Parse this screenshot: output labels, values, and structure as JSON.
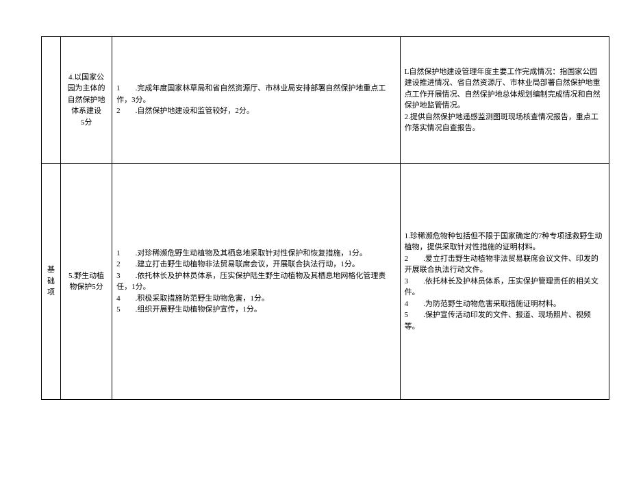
{
  "table": {
    "rows": [
      {
        "category": "",
        "item": "4.以国家公园为主体的自然保护地体系建设\n5分",
        "criteria": "1　　.完成年度国家林草局和省自然资源厅、市林业局安排部署自然保护地重点工作，3分。\n2　　.自然保护地建设和监管较好，2分。",
        "evidence": "L自然保护地建设管理年度主要工作完成情况：指国家公园建设推进情况、省自然资源厅、市林业局部署自然保护地重点工作开展情况、自然保护地总体规划编制完成情况和自然保护地监管情况。\n2.提供自然保护地遥感监测图斑现场核查情况报告，重点工作落实情况自查报告。"
      },
      {
        "category": "基础项",
        "item": "5.野生动植物保护5分",
        "criteria": "1　　.对珍稀濒危野生动植物及其栖息地采取针对性保护和恢复措施，1分。\n2　　.建立打击野生动植物非法贸易联席会议，开展联合执法行动，1分。\n3　　.依托林长及护林员体系，压实保护陆生野生动植物及其栖息地网格化管理责任，1分。\n4　　.积极采取措施防范野生动物危害，1分。\n5　　.组织开展野生动植物保护宣传，1分。",
        "evidence": "1.珍稀濒危物种包括但不限于国家确定的7种专项拯救野生动植物，提供采取针对性措施的证明材料。\n2　　.爱立打击野生动植物非法贸易联席会议文件、印发的开展联合执法行动文件。\n3　　.依托林长及护林员体系，压实保护管理责任的相关文件。\n4　　.为防范野生动物危害采取措施证明材料。\n5　　.保护宣传活动印发的文件、报道、现场照片、视频等。"
      }
    ]
  }
}
